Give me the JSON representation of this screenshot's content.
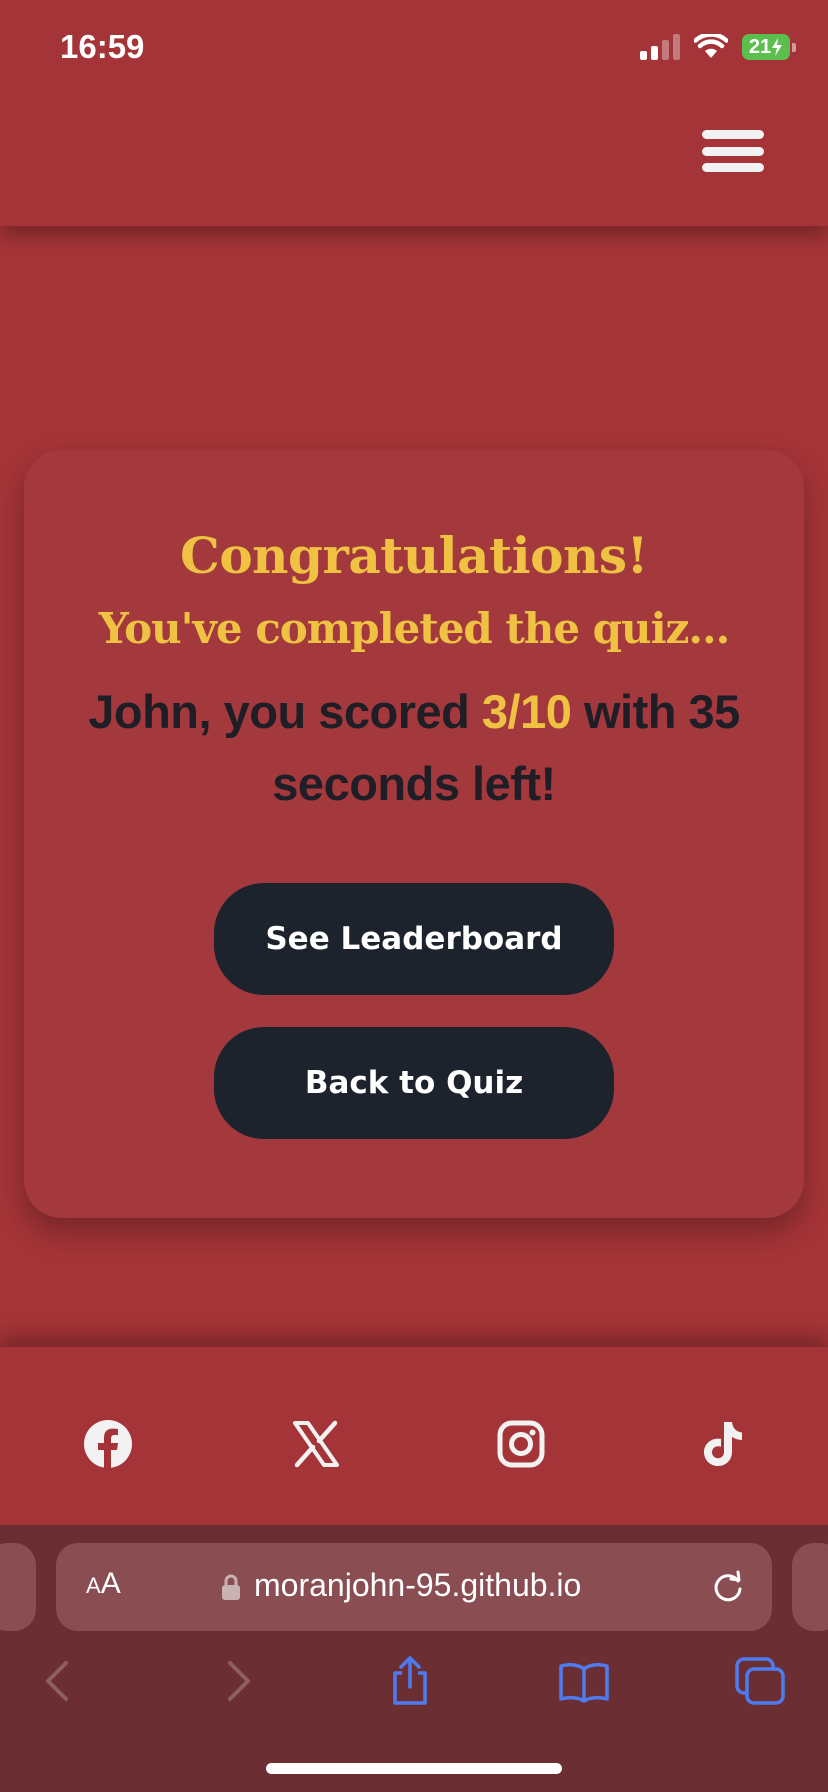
{
  "status_bar": {
    "time": "16:59",
    "battery_level": "21",
    "icons": [
      "cellular-signal-icon",
      "wifi-icon",
      "battery-charging-icon"
    ]
  },
  "header": {
    "menu_icon": "hamburger-menu-icon"
  },
  "result": {
    "heading": "Congratulations!",
    "subheading": "You've completed the quiz...",
    "score_prefix": "John, you scored ",
    "score": "3/10",
    "score_suffix": " with 35 seconds left!"
  },
  "buttons": {
    "leaderboard_label": "See Leaderboard",
    "back_label": "Back to Quiz"
  },
  "footer": {
    "social_icons": [
      "facebook-icon",
      "x-twitter-icon",
      "instagram-icon",
      "tiktok-icon"
    ]
  },
  "browser": {
    "text_size_label": "AA",
    "url": "moranjohn-95.github.io",
    "nav_icons": [
      "back-icon",
      "forward-icon",
      "share-icon",
      "bookmarks-icon",
      "tabs-icon"
    ]
  },
  "colors": {
    "background": "#a43437",
    "card": "#a3393c",
    "accent": "#f0c243",
    "button": "#1c232c",
    "text_dark": "#1f1e26"
  }
}
